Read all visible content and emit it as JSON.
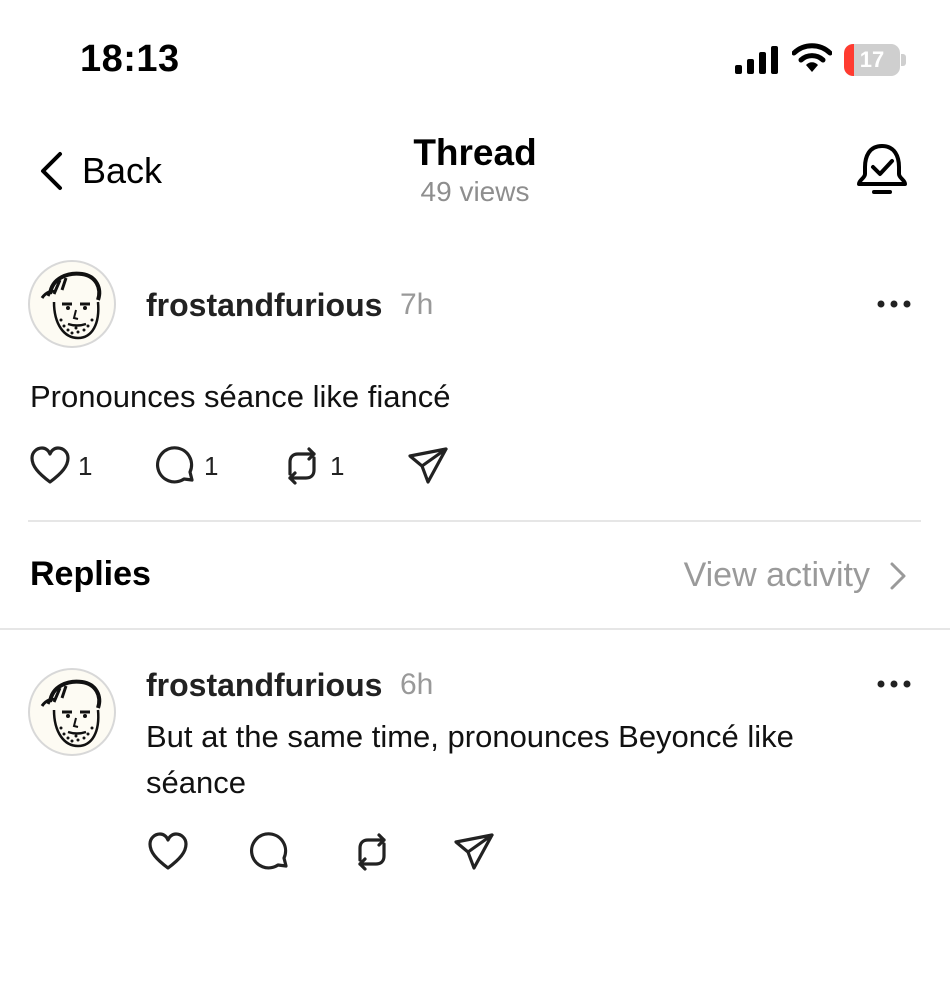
{
  "status_bar": {
    "time": "18:13",
    "battery": "17",
    "battery_level": 0.17
  },
  "nav": {
    "back_label": "Back",
    "title": "Thread",
    "views": "49 views"
  },
  "post": {
    "username": "frostandfurious",
    "time": "7h",
    "text": "Pronounces séance like fiancé",
    "likes": "1",
    "replies": "1",
    "reposts": "1"
  },
  "replies_header": {
    "title": "Replies",
    "view_activity": "View activity"
  },
  "reply": {
    "username": "frostandfurious",
    "time": "6h",
    "text_line1": "But at the same time, pronounces Beyoncé like",
    "text_line2": "séance"
  },
  "icons": [
    "chevron-left-icon",
    "bell-check-icon",
    "more-icon",
    "heart-icon",
    "comment-icon",
    "repost-icon",
    "send-icon",
    "chevron-right-icon"
  ]
}
